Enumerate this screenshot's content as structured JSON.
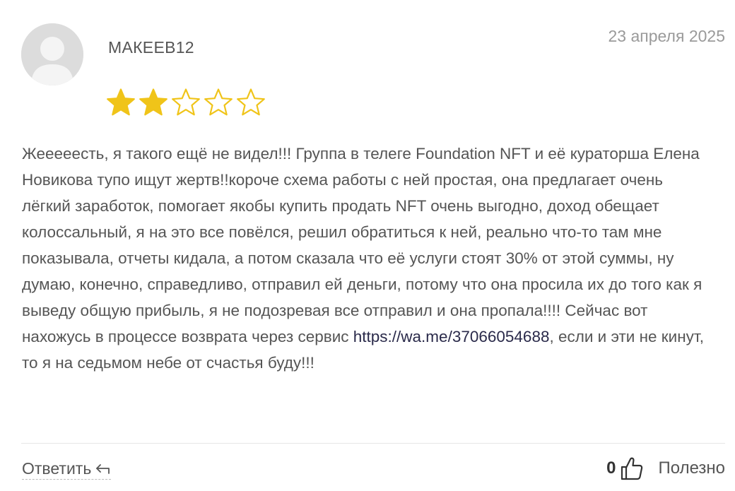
{
  "review": {
    "author": "МАКЕЕВ12",
    "date": "23 апреля 2025",
    "rating": 2,
    "max_rating": 5,
    "star_color": "#f0c419",
    "text_before_link": "Жееееесть, я такого ещё не видел!!! Группа в телеге Foundation NFT и её кураторша Елена Новикова тупо ищут жертв!!короче схема работы с ней простая, она предлагает очень лёгкий заработок, помогает якобы купить продать NFT очень выгодно, доход обещает колоссальный, я на это все повёлся, решил обратиться к ней, реально что-то там мне показывала, отчеты кидала, а потом сказала что её услуги стоят 30% от этой суммы, ну думаю, конечно, справедливо, отправил ей деньги, потому что она просила их до того как я выведу общую прибыль, я не подозревая все отправил и она пропала!!!! Сейчас вот нахожусь в процессе возврата через сервис ",
    "link": "https://wa.me/37066054688",
    "text_after_link": ", если и эти не кинут, то я на седьмом небе от счастья буду!!!"
  },
  "actions": {
    "reply_label": "Ответить",
    "reply_icon": "reply-arrow-icon",
    "like_count": "0",
    "like_icon": "thumbs-up-icon",
    "helpful_label": "Полезно"
  }
}
